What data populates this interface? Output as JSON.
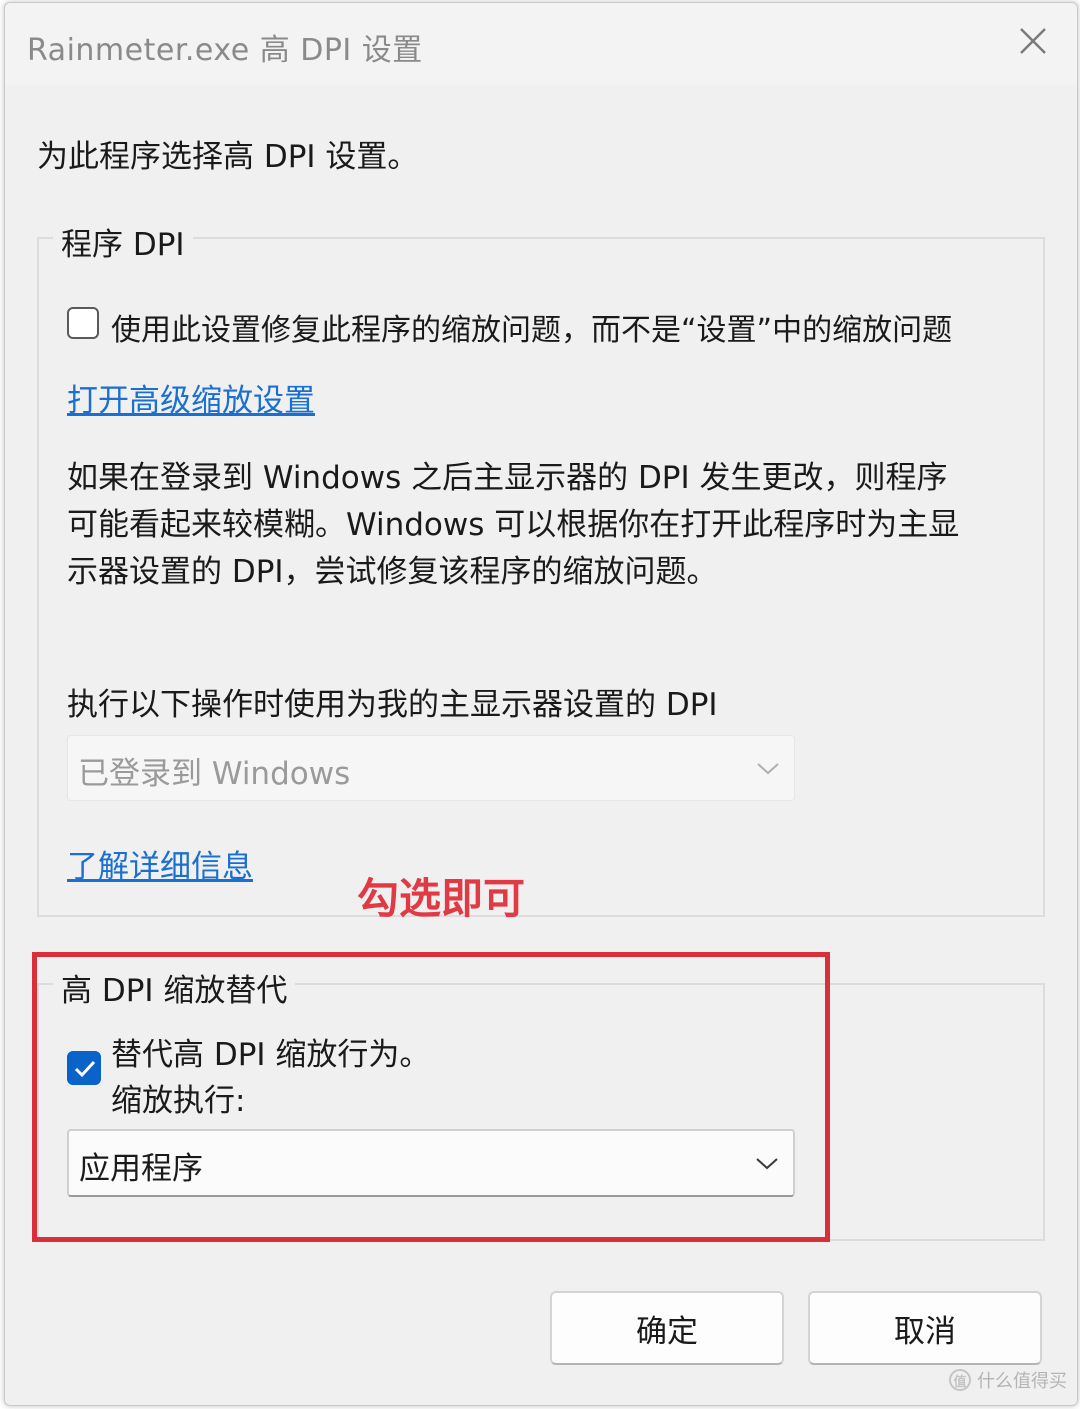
{
  "window": {
    "title": "Rainmeter.exe 高 DPI 设置",
    "close_icon": "close-icon"
  },
  "prompt": "为此程序选择高 DPI 设置。",
  "program_dpi": {
    "legend": "程序 DPI",
    "checkbox_label": "使用此设置修复此程序的缩放问题，而不是“设置”中的缩放问题",
    "checkbox_checked": false,
    "advanced_link": "打开高级缩放设置",
    "description_lines": [
      "如果在登录到 Windows 之后主显示器的 DPI 发生更改，则程序",
      "可能看起来较模糊。Windows 可以根据你在打开此程序时为主显",
      "示器设置的 DPI，尝试修复该程序的缩放问题。"
    ],
    "use_dpi_label": "执行以下操作时使用为我的主显示器设置的 DPI",
    "dropdown_value": "已登录到 Windows",
    "dropdown_disabled": true,
    "learn_more_link": "了解详细信息"
  },
  "annotation": {
    "text": "勾选即可",
    "color": "#e03a44"
  },
  "override": {
    "legend": "高 DPI 缩放替代",
    "checkbox_label": "替代高 DPI 缩放行为。",
    "checkbox_checked": true,
    "scaling_label": "缩放执行:",
    "dropdown_value": "应用程序"
  },
  "buttons": {
    "ok": "确定",
    "cancel": "取消"
  },
  "watermark": {
    "logo": "值",
    "text": "什么值得买"
  },
  "colors": {
    "accent": "#0a63c9",
    "link": "#1b6fd0",
    "highlight_border": "#d8303a"
  }
}
